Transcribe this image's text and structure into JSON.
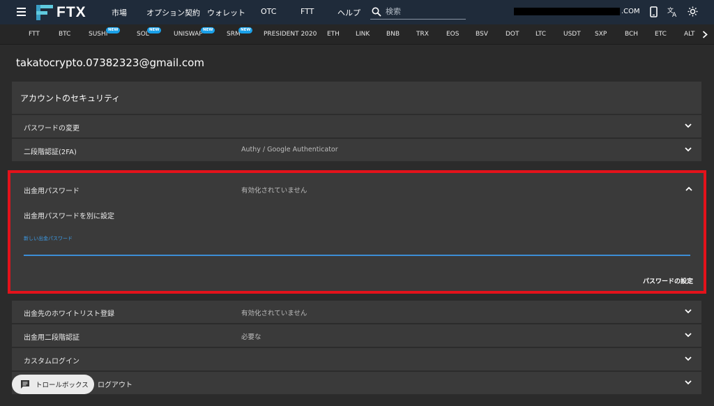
{
  "header": {
    "logo_text": "FTX",
    "nav": [
      "市場",
      "オプション契約",
      "ウォレット",
      "OTC",
      "FTT",
      "ヘルプ"
    ],
    "search_placeholder": "検索",
    "account_suffix": ".COM"
  },
  "ticker": {
    "items": [
      {
        "label": "FTT",
        "new": false
      },
      {
        "label": "BTC",
        "new": false
      },
      {
        "label": "SUSHI",
        "new": true
      },
      {
        "label": "SOL",
        "new": true
      },
      {
        "label": "UNISWAP",
        "new": true
      },
      {
        "label": "SRM",
        "new": true
      },
      {
        "label": "PRESIDENT 2020",
        "new": false
      },
      {
        "label": "ETH",
        "new": false
      },
      {
        "label": "LINK",
        "new": false
      },
      {
        "label": "BNB",
        "new": false
      },
      {
        "label": "TRX",
        "new": false
      },
      {
        "label": "EOS",
        "new": false
      },
      {
        "label": "BSV",
        "new": false
      },
      {
        "label": "DOT",
        "new": false
      },
      {
        "label": "LTC",
        "new": false
      },
      {
        "label": "USDT",
        "new": false
      },
      {
        "label": "SXP",
        "new": false
      },
      {
        "label": "BCH",
        "new": false
      },
      {
        "label": "ETC",
        "new": false
      },
      {
        "label": "ALT",
        "new": false
      }
    ],
    "new_badge": "NEW"
  },
  "email": "takatocrypto.07382323@gmail.com",
  "security": {
    "title": "アカウントのセキュリティ",
    "rows_top": [
      {
        "label": "パスワードの変更",
        "value": ""
      },
      {
        "label": "二段階認証(2FA)",
        "value": "Authy / Google Authenticator"
      }
    ],
    "withdraw_password": {
      "label": "出金用パスワード",
      "value": "有効化されていません",
      "subtitle": "出金用パスワードを別に設定",
      "field_label": "新しい出金パスワード",
      "field_value": "",
      "button": "パスワードの設定"
    },
    "rows_bottom": [
      {
        "label": "出金先のホワイトリスト登録",
        "value": "有効化されていません"
      },
      {
        "label": "出金用二段階認証",
        "value": "必要な"
      },
      {
        "label": "カスタムログイン",
        "value": ""
      },
      {
        "label": "ログアウト",
        "value": ""
      }
    ]
  },
  "trollbox": {
    "label": "トロールボックス"
  }
}
